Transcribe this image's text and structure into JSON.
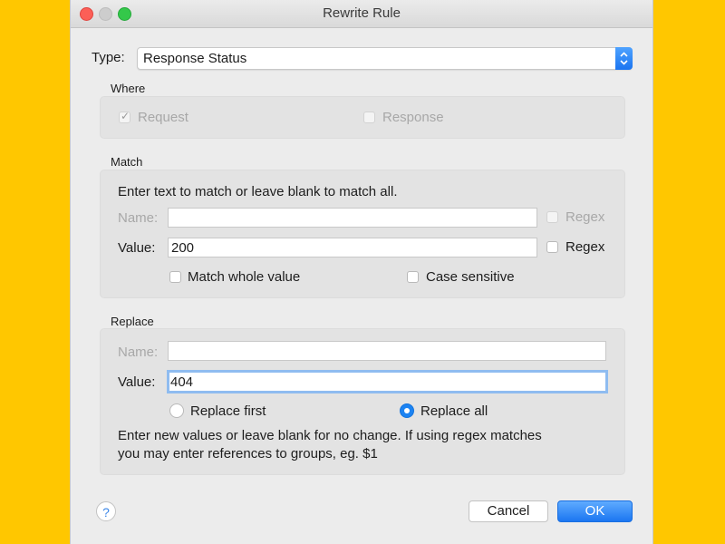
{
  "window": {
    "title": "Rewrite Rule"
  },
  "type": {
    "label": "Type:",
    "value": "Response Status"
  },
  "where": {
    "title": "Where",
    "request_label": "Request",
    "response_label": "Response"
  },
  "match": {
    "title": "Match",
    "instructions": "Enter text to match or leave blank to match all.",
    "name_label": "Name:",
    "name_value": "",
    "name_regex_label": "Regex",
    "value_label": "Value:",
    "value_value": "200",
    "value_regex_label": "Regex",
    "whole_value_label": "Match whole value",
    "case_sensitive_label": "Case sensitive"
  },
  "replace": {
    "title": "Replace",
    "name_label": "Name:",
    "name_value": "",
    "value_label": "Value:",
    "value_value": "404",
    "replace_first_label": "Replace first",
    "replace_all_label": "Replace all",
    "note_line1": "Enter new values or leave blank for no change. If using regex matches",
    "note_line2": "you may enter references to groups, eg. $1"
  },
  "buttons": {
    "help": "?",
    "cancel": "Cancel",
    "ok": "OK"
  }
}
